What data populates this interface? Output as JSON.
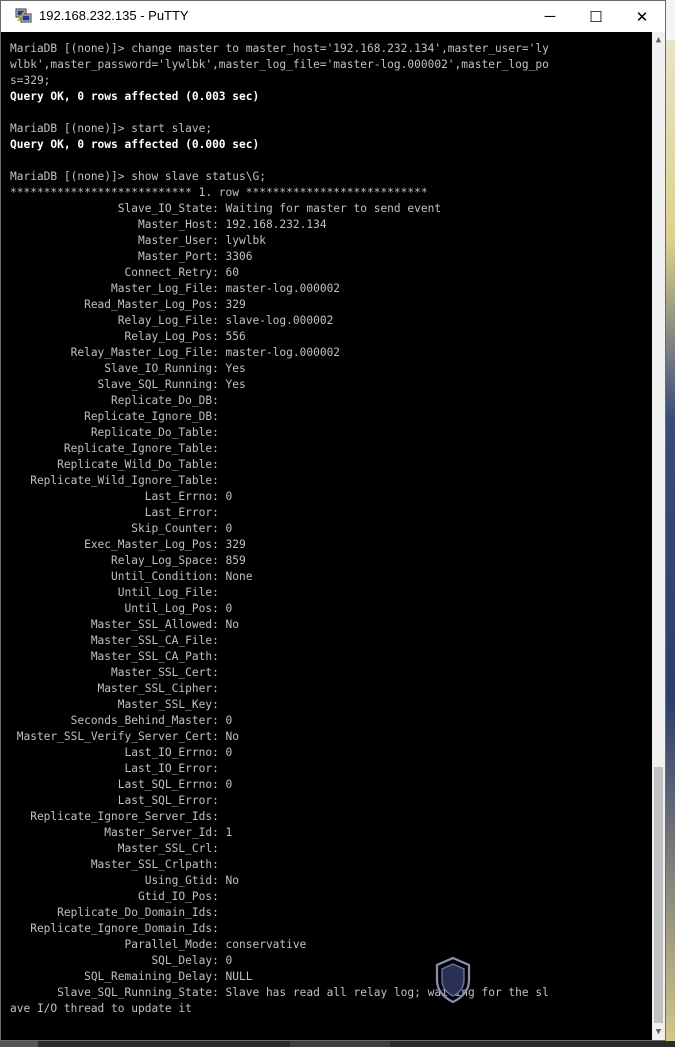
{
  "window": {
    "title": "192.168.232.135 - PuTTY",
    "controls": {
      "minimize": "─",
      "maximize": "☐",
      "close": "✕"
    },
    "icon": "putty-icon"
  },
  "terminal": {
    "lines": [
      {
        "text": "MariaDB [(none)]> change master to master_host='192.168.232.134',master_user='ly",
        "bright": false
      },
      {
        "text": "wlbk',master_password='lywlbk',master_log_file='master-log.000002',master_log_po",
        "bright": false
      },
      {
        "text": "s=329;",
        "bright": false
      },
      {
        "text": "Query OK, 0 rows affected (0.003 sec)",
        "bright": true
      },
      {
        "text": "",
        "bright": false
      },
      {
        "text": "MariaDB [(none)]> start slave;",
        "bright": false
      },
      {
        "text": "Query OK, 0 rows affected (0.000 sec)",
        "bright": true
      },
      {
        "text": "",
        "bright": false
      },
      {
        "text": "MariaDB [(none)]> show slave status\\G;",
        "bright": false
      },
      {
        "text": "*************************** 1. row ***************************",
        "bright": false
      },
      {
        "text": "                Slave_IO_State: Waiting for master to send event",
        "bright": false
      },
      {
        "text": "                   Master_Host: 192.168.232.134",
        "bright": false
      },
      {
        "text": "                   Master_User: lywlbk",
        "bright": false
      },
      {
        "text": "                   Master_Port: 3306",
        "bright": false
      },
      {
        "text": "                 Connect_Retry: 60",
        "bright": false
      },
      {
        "text": "               Master_Log_File: master-log.000002",
        "bright": false
      },
      {
        "text": "           Read_Master_Log_Pos: 329",
        "bright": false
      },
      {
        "text": "                Relay_Log_File: slave-log.000002",
        "bright": false
      },
      {
        "text": "                 Relay_Log_Pos: 556",
        "bright": false
      },
      {
        "text": "         Relay_Master_Log_File: master-log.000002",
        "bright": false
      },
      {
        "text": "              Slave_IO_Running: Yes",
        "bright": false
      },
      {
        "text": "             Slave_SQL_Running: Yes",
        "bright": false
      },
      {
        "text": "               Replicate_Do_DB: ",
        "bright": false
      },
      {
        "text": "           Replicate_Ignore_DB: ",
        "bright": false
      },
      {
        "text": "            Replicate_Do_Table: ",
        "bright": false
      },
      {
        "text": "        Replicate_Ignore_Table: ",
        "bright": false
      },
      {
        "text": "       Replicate_Wild_Do_Table: ",
        "bright": false
      },
      {
        "text": "   Replicate_Wild_Ignore_Table: ",
        "bright": false
      },
      {
        "text": "                    Last_Errno: 0",
        "bright": false
      },
      {
        "text": "                    Last_Error: ",
        "bright": false
      },
      {
        "text": "                  Skip_Counter: 0",
        "bright": false
      },
      {
        "text": "           Exec_Master_Log_Pos: 329",
        "bright": false
      },
      {
        "text": "               Relay_Log_Space: 859",
        "bright": false
      },
      {
        "text": "               Until_Condition: None",
        "bright": false
      },
      {
        "text": "                Until_Log_File: ",
        "bright": false
      },
      {
        "text": "                 Until_Log_Pos: 0",
        "bright": false
      },
      {
        "text": "            Master_SSL_Allowed: No",
        "bright": false
      },
      {
        "text": "            Master_SSL_CA_File: ",
        "bright": false
      },
      {
        "text": "            Master_SSL_CA_Path: ",
        "bright": false
      },
      {
        "text": "               Master_SSL_Cert: ",
        "bright": false
      },
      {
        "text": "             Master_SSL_Cipher: ",
        "bright": false
      },
      {
        "text": "                Master_SSL_Key: ",
        "bright": false
      },
      {
        "text": "         Seconds_Behind_Master: 0",
        "bright": false
      },
      {
        "text": " Master_SSL_Verify_Server_Cert: No",
        "bright": false
      },
      {
        "text": "                 Last_IO_Errno: 0",
        "bright": false
      },
      {
        "text": "                 Last_IO_Error: ",
        "bright": false
      },
      {
        "text": "                Last_SQL_Errno: 0",
        "bright": false
      },
      {
        "text": "                Last_SQL_Error: ",
        "bright": false
      },
      {
        "text": "   Replicate_Ignore_Server_Ids: ",
        "bright": false
      },
      {
        "text": "              Master_Server_Id: 1",
        "bright": false
      },
      {
        "text": "                Master_SSL_Crl: ",
        "bright": false
      },
      {
        "text": "            Master_SSL_Crlpath: ",
        "bright": false
      },
      {
        "text": "                    Using_Gtid: No",
        "bright": false
      },
      {
        "text": "                   Gtid_IO_Pos: ",
        "bright": false
      },
      {
        "text": "       Replicate_Do_Domain_Ids: ",
        "bright": false
      },
      {
        "text": "   Replicate_Ignore_Domain_Ids: ",
        "bright": false
      },
      {
        "text": "                 Parallel_Mode: conservative",
        "bright": false
      },
      {
        "text": "                     SQL_Delay: 0",
        "bright": false
      },
      {
        "text": "           SQL_Remaining_Delay: NULL",
        "bright": false
      },
      {
        "text": "       Slave_SQL_Running_State: Slave has read all relay log; waiting for the sl",
        "bright": false
      },
      {
        "text": "ave I/O thread to update it",
        "bright": false
      }
    ]
  },
  "scrollbar": {
    "up_arrow": "▲",
    "down_arrow": "▼"
  },
  "colors": {
    "terminal_bg": "#000000",
    "terminal_fg": "#c0c0c0",
    "bright_fg": "#ffffff"
  }
}
